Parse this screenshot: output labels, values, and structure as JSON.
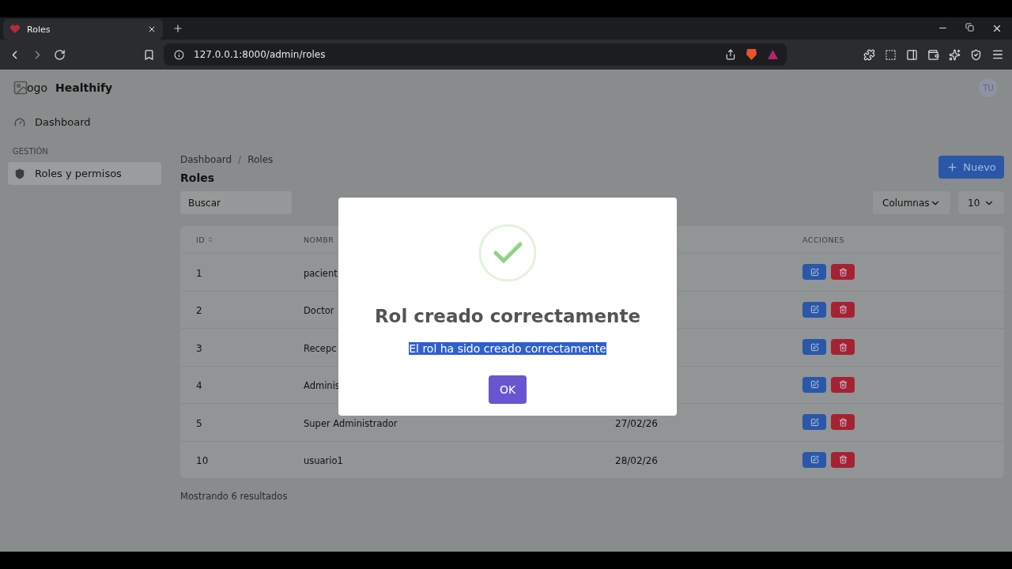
{
  "browser": {
    "tab": {
      "title": "Roles"
    },
    "url": "127.0.0.1:8000/admin/roles"
  },
  "app": {
    "brand": {
      "logo_alt": "ogo",
      "name": "Healthify"
    },
    "user_initials": "TU"
  },
  "sidebar": {
    "top_items": [
      {
        "label": "Dashboard",
        "selected": false
      }
    ],
    "section_heading": "GESTIÓN",
    "section_items": [
      {
        "label": "Roles y permisos",
        "selected": true
      }
    ]
  },
  "breadcrumb": [
    "Dashboard",
    "Roles"
  ],
  "breadcrumb_separator": "/",
  "title": "Roles",
  "new_button": "Nuevo",
  "search": {
    "placeholder": "Buscar"
  },
  "columns_button": "Columnas",
  "page_size": "10",
  "table": {
    "columns": [
      {
        "kind": "id",
        "label": "ID",
        "sortable": true
      },
      {
        "kind": "name",
        "label": "NOMBR",
        "sortable": false
      },
      {
        "kind": "actions",
        "label": "ACCIONES",
        "sortable": false
      }
    ],
    "rows": [
      {
        "id": "1",
        "name": "pacient"
      },
      {
        "id": "2",
        "name": "Doctor"
      },
      {
        "id": "3",
        "name": "Recepc"
      },
      {
        "id": "4",
        "name": "Adminis"
      },
      {
        "id": "5",
        "name": "Super Administrador",
        "date": "27/02/26"
      },
      {
        "id": "10",
        "name": "usuario1",
        "date": "28/02/26"
      }
    ]
  },
  "footer": "Mostrando 6 resultados",
  "dialog": {
    "title": "Rol creado correctamente",
    "message": "El rol ha sido creado correctamente",
    "message_selected": true,
    "confirm": "OK"
  }
}
